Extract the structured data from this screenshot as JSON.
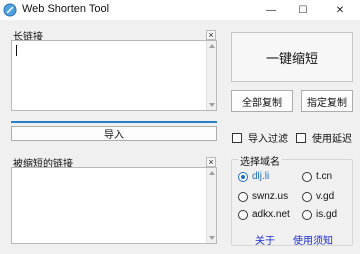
{
  "window": {
    "title": "Web Shorten Tool",
    "controls": {
      "minimize": "—",
      "maximize": "☐",
      "close": "✕"
    }
  },
  "long_link": {
    "label": "长链接",
    "clear": "×",
    "value": ""
  },
  "import_button": "导入",
  "shortened": {
    "label": "被缩短的链接",
    "clear": "×",
    "value": ""
  },
  "actions": {
    "shorten": "一键缩短",
    "copy_all": "全部复制",
    "copy_selected": "指定复制"
  },
  "options": {
    "import_filter": "导入过滤",
    "use_delay": "使用延迟"
  },
  "domain_group": {
    "label": "选择域名",
    "domains": [
      "dlj.li",
      "t.cn",
      "swnz.us",
      "v.gd",
      "adkx.net",
      "is.gd"
    ],
    "selected": "dlj.li"
  },
  "footer_links": {
    "about": "关于",
    "instructions": "使用须知"
  },
  "colors": {
    "accent": "#2c7fc7",
    "link": "#1c2dd6",
    "radio_selected": "#1f6fc3"
  }
}
